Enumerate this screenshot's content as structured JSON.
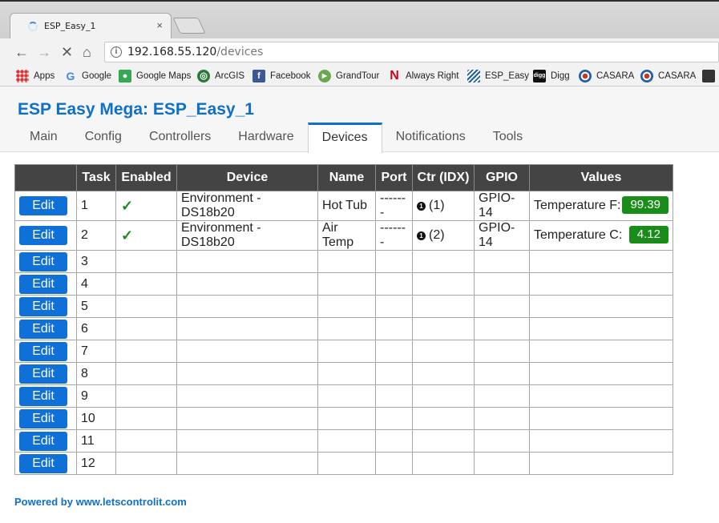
{
  "browser": {
    "tab_title": "ESP_Easy_1",
    "tab_close": "×",
    "url_host": "192.168.55.120",
    "url_path": "/devices",
    "bookmarks": [
      {
        "label": "Apps",
        "icon": "apps-grid-icon",
        "color": "#e0e0e0"
      },
      {
        "label": "Google",
        "icon": "google-g-icon",
        "color": "#4285f4"
      },
      {
        "label": "Google Maps",
        "icon": "google-maps-icon",
        "color": "#34a853"
      },
      {
        "label": "ArcGIS",
        "icon": "arcgis-globe-icon",
        "color": "#2b7a3b"
      },
      {
        "label": "Facebook",
        "icon": "facebook-icon",
        "color": "#3b5998"
      },
      {
        "label": "GrandTour",
        "icon": "grandtour-play-icon",
        "color": "#6aa84f"
      },
      {
        "label": "Always Right",
        "icon": "always-right-n-icon",
        "color": "#d0021b"
      },
      {
        "label": "ESP_Easy",
        "icon": "esp-easy-stripes-icon",
        "color": "#1f5fa8"
      },
      {
        "label": "Digg",
        "icon": "digg-icon",
        "color": "#111111"
      },
      {
        "label": "CASARA",
        "icon": "casara-roundel-icon",
        "color": "#c0392b"
      },
      {
        "label": "CASARA",
        "icon": "casara-roundel-icon",
        "color": "#c0392b"
      }
    ]
  },
  "page": {
    "title": "ESP Easy Mega: ESP_Easy_1",
    "nav": [
      "Main",
      "Config",
      "Controllers",
      "Hardware",
      "Devices",
      "Notifications",
      "Tools"
    ],
    "active_nav": "Devices",
    "table": {
      "headers": [
        "",
        "Task",
        "Enabled",
        "Device",
        "Name",
        "Port",
        "Ctr (IDX)",
        "GPIO",
        "Values"
      ],
      "edit_label": "Edit",
      "check_mark": "✓",
      "ctr_dot": "1",
      "rows": [
        {
          "task": "1",
          "enabled": true,
          "device": "Environment - DS18b20",
          "name": "Hot Tub",
          "port": "-------",
          "ctr": "(1)",
          "gpio": "GPIO-14",
          "value_label": "Temperature F:",
          "value": "99.39"
        },
        {
          "task": "2",
          "enabled": true,
          "device": "Environment - DS18b20",
          "name": "Air Temp",
          "port": "-------",
          "ctr": "(2)",
          "gpio": "GPIO-14",
          "value_label": "Temperature C:",
          "value": "4.12"
        },
        {
          "task": "3"
        },
        {
          "task": "4"
        },
        {
          "task": "5"
        },
        {
          "task": "6"
        },
        {
          "task": "7"
        },
        {
          "task": "8"
        },
        {
          "task": "9"
        },
        {
          "task": "10"
        },
        {
          "task": "11"
        },
        {
          "task": "12"
        }
      ]
    },
    "footer": "Powered by www.letscontrolit.com"
  },
  "colors": {
    "accent": "#0f70c8",
    "button": "#0f70d8",
    "value_badge": "#1a8c1a",
    "header_bg": "#444444"
  }
}
